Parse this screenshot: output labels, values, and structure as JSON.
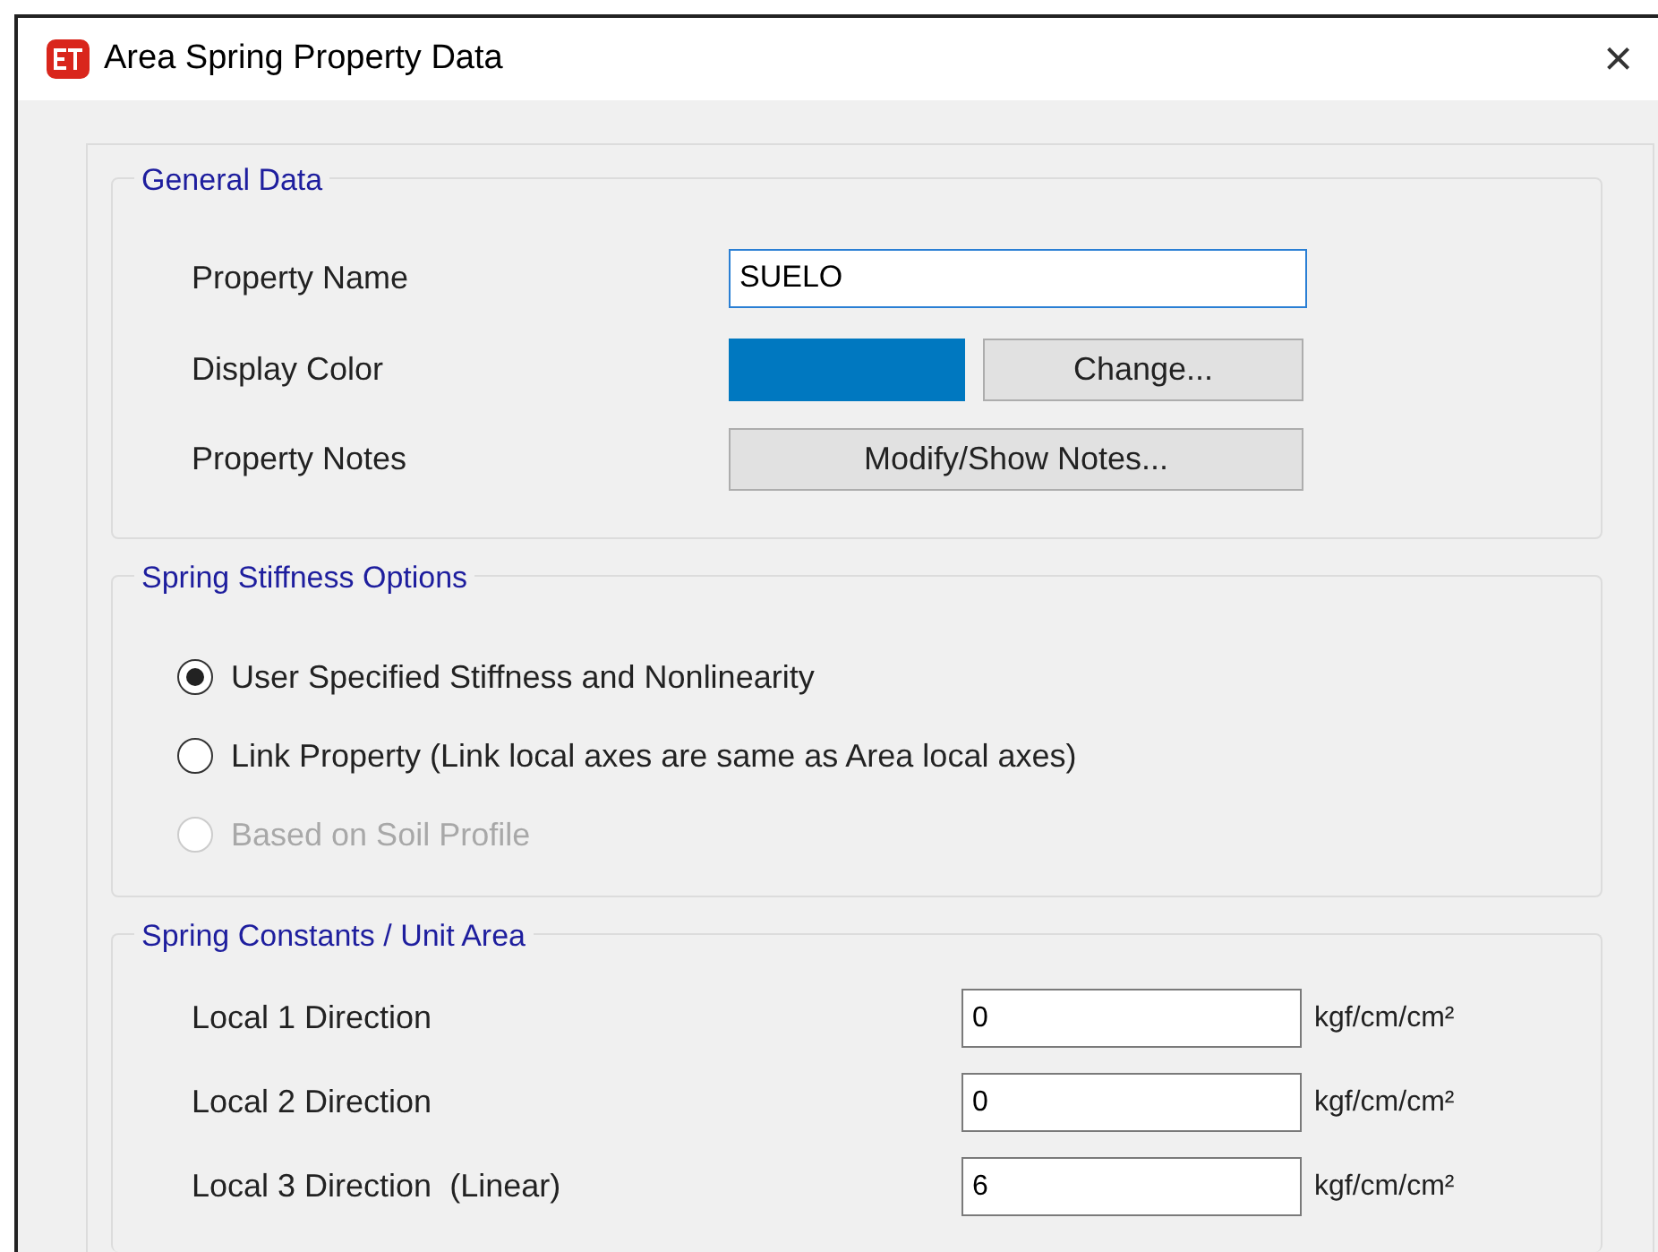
{
  "window": {
    "title": "Area Spring Property Data",
    "close": "×"
  },
  "general_data": {
    "title": "General Data",
    "property_name": {
      "label": "Property Name",
      "value": "SUELO"
    },
    "display_color": {
      "label": "Display Color",
      "color": "#0078c0",
      "button": "Change..."
    },
    "property_notes": {
      "label": "Property Notes",
      "button": "Modify/Show Notes..."
    }
  },
  "spring_stiffness_options": {
    "title": "Spring Stiffness Options",
    "options": [
      {
        "label": "User Specified Stiffness and Nonlinearity",
        "selected": true,
        "disabled": false
      },
      {
        "label": "Link Property (Link local axes are same as Area local axes)",
        "selected": false,
        "disabled": false
      },
      {
        "label": "Based on Soil Profile",
        "selected": false,
        "disabled": true
      }
    ]
  },
  "spring_constants": {
    "title": "Spring Constants / Unit Area",
    "rows": [
      {
        "label": "Local 1 Direction",
        "value": "0",
        "unit": "kgf/cm/cm²"
      },
      {
        "label": "Local 2 Direction",
        "value": "0",
        "unit": "kgf/cm/cm²"
      },
      {
        "label": "Local 3 Direction  (Linear)",
        "value": "6",
        "unit": "kgf/cm/cm²"
      }
    ]
  }
}
